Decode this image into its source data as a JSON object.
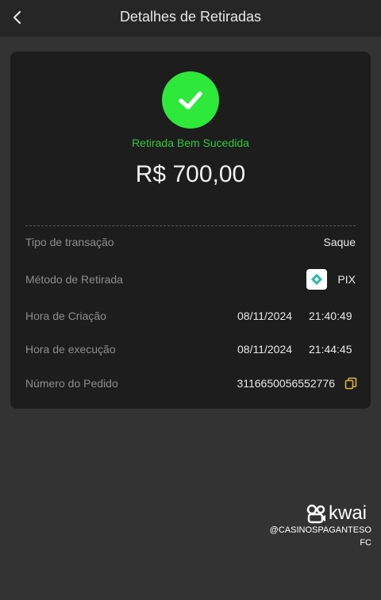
{
  "header": {
    "title": "Detalhes de Retiradas",
    "back_icon": "chevron-left-icon"
  },
  "status": {
    "icon": "check-icon",
    "text": "Retirada Bem Sucedida",
    "color": "#2ee83a"
  },
  "amount": "R$ 700,00",
  "details": {
    "transaction_type": {
      "label": "Tipo de transação",
      "value": "Saque"
    },
    "withdraw_method": {
      "label": "Método de Retirada",
      "icon": "pix-icon",
      "value": "PIX"
    },
    "created": {
      "label": "Hora de Criação",
      "date": "08/11/2024",
      "time": "21:40:49"
    },
    "executed": {
      "label": "Hora de execução",
      "date": "08/11/2024",
      "time": "21:44:45"
    },
    "order": {
      "label": "Número do Pedido",
      "value": "3116650056552776",
      "icon": "copy-icon"
    }
  },
  "watermark": {
    "brand": "kwai",
    "handle_line1": "@CASINOSPAGANTESO",
    "handle_line2": "FC"
  }
}
